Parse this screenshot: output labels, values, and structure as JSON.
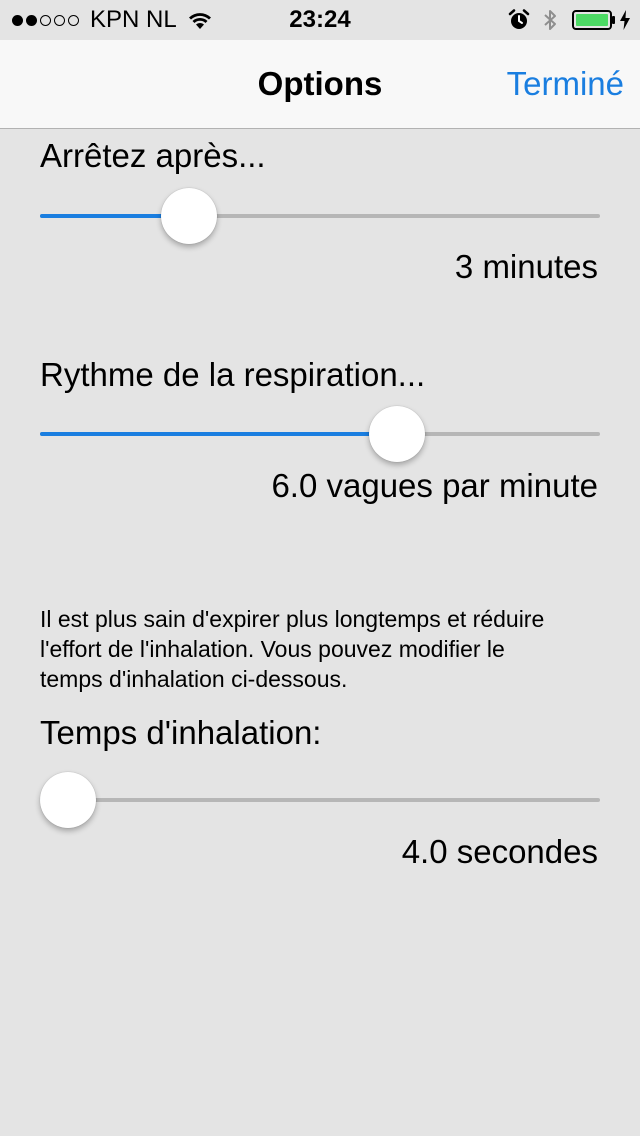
{
  "status_bar": {
    "signal_full": 2,
    "signal_total": 5,
    "carrier": "KPN NL",
    "time": "23:24",
    "battery_color": "#4cd964"
  },
  "nav": {
    "title": "Options",
    "done_label": "Terminé",
    "accent_color": "#1a7ee0"
  },
  "settings": {
    "stop_after": {
      "label": "Arrêtez après...",
      "value_text": "3 minutes",
      "slider_fraction": 0.241
    },
    "breathing_rate": {
      "label": "Rythme de la respiration...",
      "value_text": "6.0 vagues par minute",
      "slider_fraction": 0.652
    },
    "info": "Il est plus sain d'expirer plus longtemps et réduire l'effort de l'inhalation. Vous pouvez modifier le temps d'inhalation ci-dessous.",
    "inhalation_time": {
      "label": "Temps d'inhalation:",
      "value_text": "4.0 secondes",
      "slider_fraction": 0.0
    }
  }
}
